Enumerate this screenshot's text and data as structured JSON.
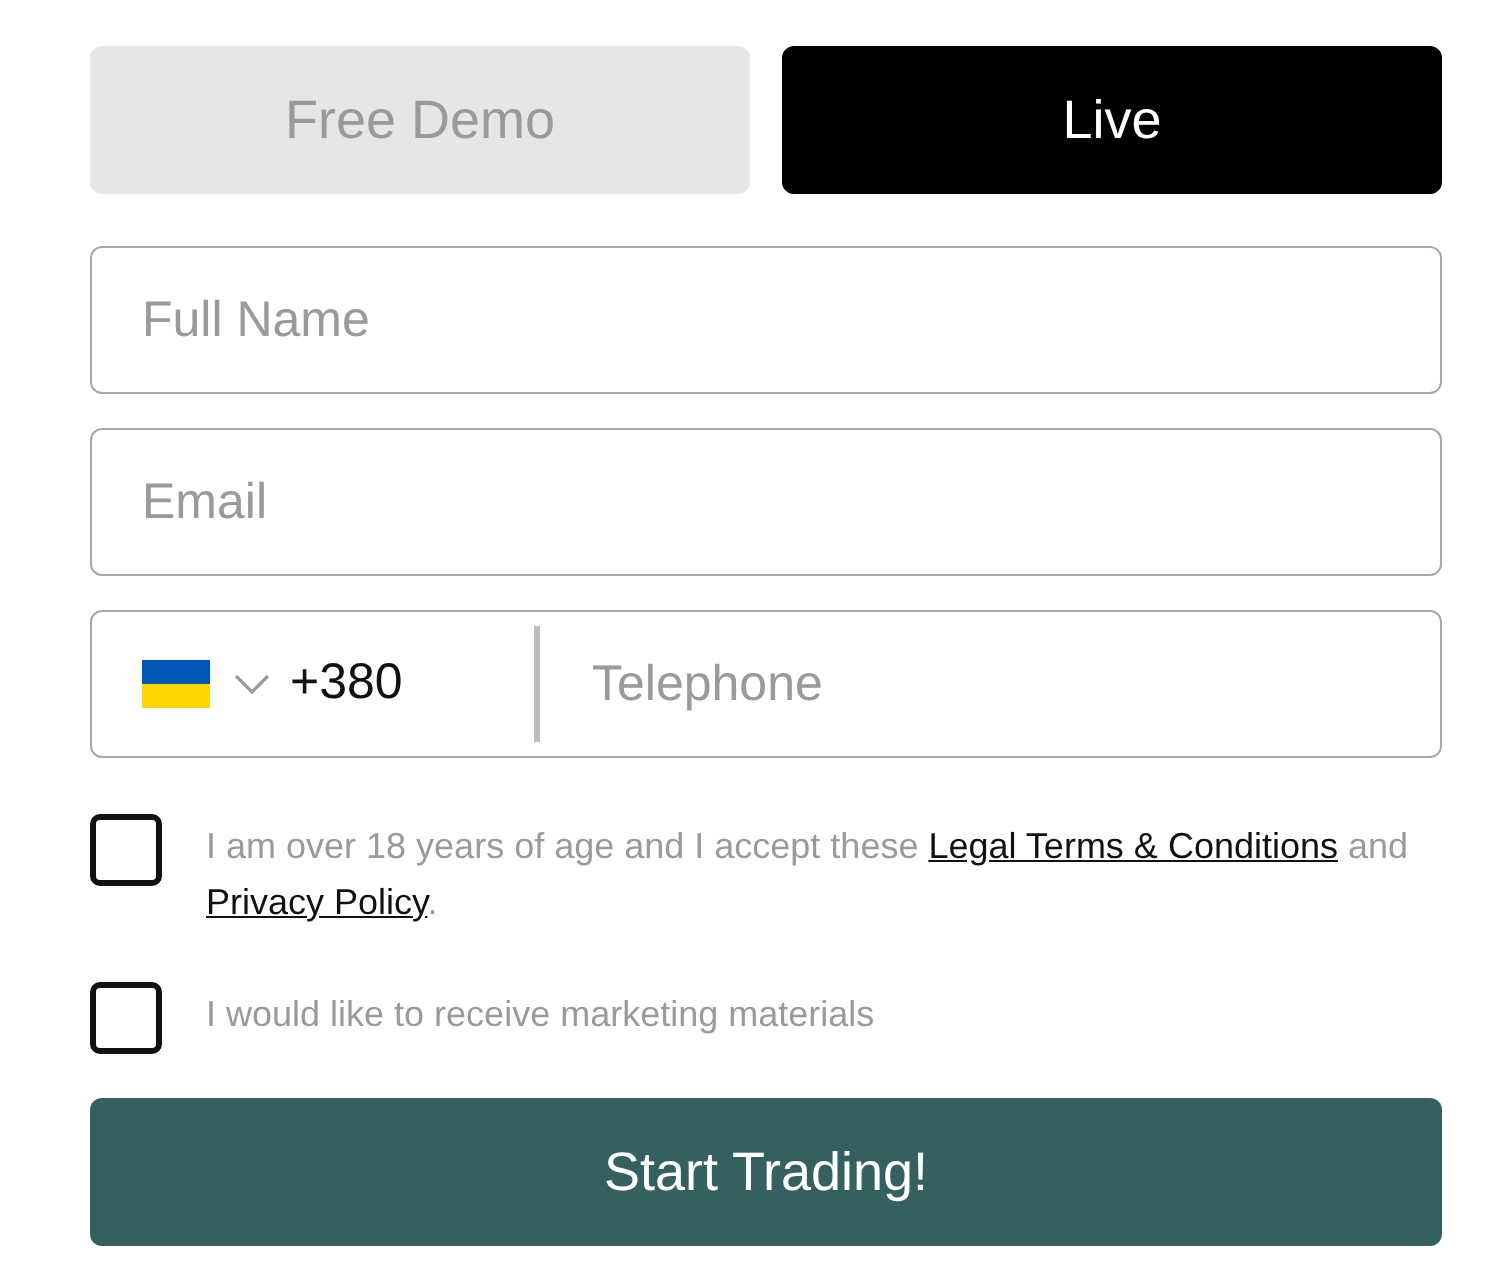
{
  "tabs": [
    {
      "label": "Free Demo",
      "selected": false
    },
    {
      "label": "Live",
      "selected": true
    }
  ],
  "fields": [
    {
      "kind": "text",
      "placeholder": "Full Name"
    },
    {
      "kind": "text",
      "placeholder": "Email"
    },
    {
      "kind": "phone",
      "dial_code": "+380",
      "placeholder": "Telephone"
    }
  ],
  "checkboxes": [
    {
      "checked": false,
      "parts": [
        {
          "kind": "text",
          "text": "I am over 18 years of age and I accept these "
        },
        {
          "kind": "link",
          "text": "Legal Terms & Conditions"
        },
        {
          "kind": "text",
          "text": " and "
        },
        {
          "kind": "link",
          "text": "Privacy Policy"
        },
        {
          "kind": "text",
          "text": "."
        }
      ]
    },
    {
      "checked": false,
      "parts": [
        {
          "kind": "text",
          "text": "I would like to receive marketing materials"
        }
      ]
    }
  ],
  "submit": "Start Trading!"
}
